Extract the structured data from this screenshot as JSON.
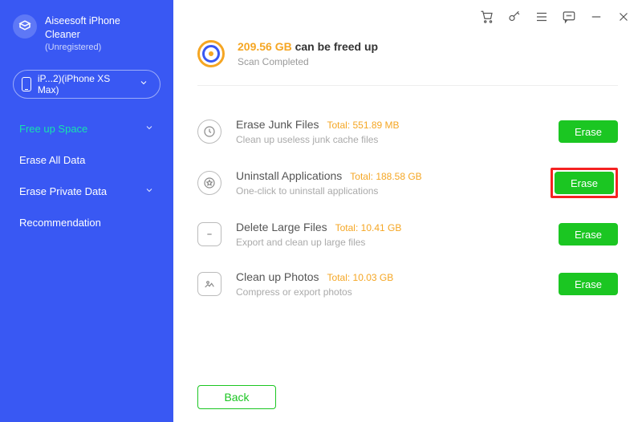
{
  "brand": {
    "line1": "Aiseesoft iPhone",
    "line2": "Cleaner",
    "status": "(Unregistered)"
  },
  "device": {
    "label": "iP...2)(iPhone XS Max)"
  },
  "nav": {
    "free_up_space": "Free up Space",
    "erase_all_data": "Erase All Data",
    "erase_private_data": "Erase Private Data",
    "recommendation": "Recommendation"
  },
  "summary": {
    "size": "209.56 GB",
    "suffix": "can be freed up",
    "sub": "Scan Completed"
  },
  "rows": {
    "junk": {
      "title": "Erase Junk Files",
      "total": "Total: 551.89 MB",
      "sub": "Clean up useless junk cache files",
      "btn": "Erase"
    },
    "apps": {
      "title": "Uninstall Applications",
      "total": "Total: 188.58 GB",
      "sub": "One-click to uninstall applications",
      "btn": "Erase"
    },
    "large": {
      "title": "Delete Large Files",
      "total": "Total: 10.41 GB",
      "sub": "Export and clean up large files",
      "btn": "Erase"
    },
    "photo": {
      "title": "Clean up Photos",
      "total": "Total: 10.03 GB",
      "sub": "Compress or export photos",
      "btn": "Erase"
    }
  },
  "back": "Back"
}
